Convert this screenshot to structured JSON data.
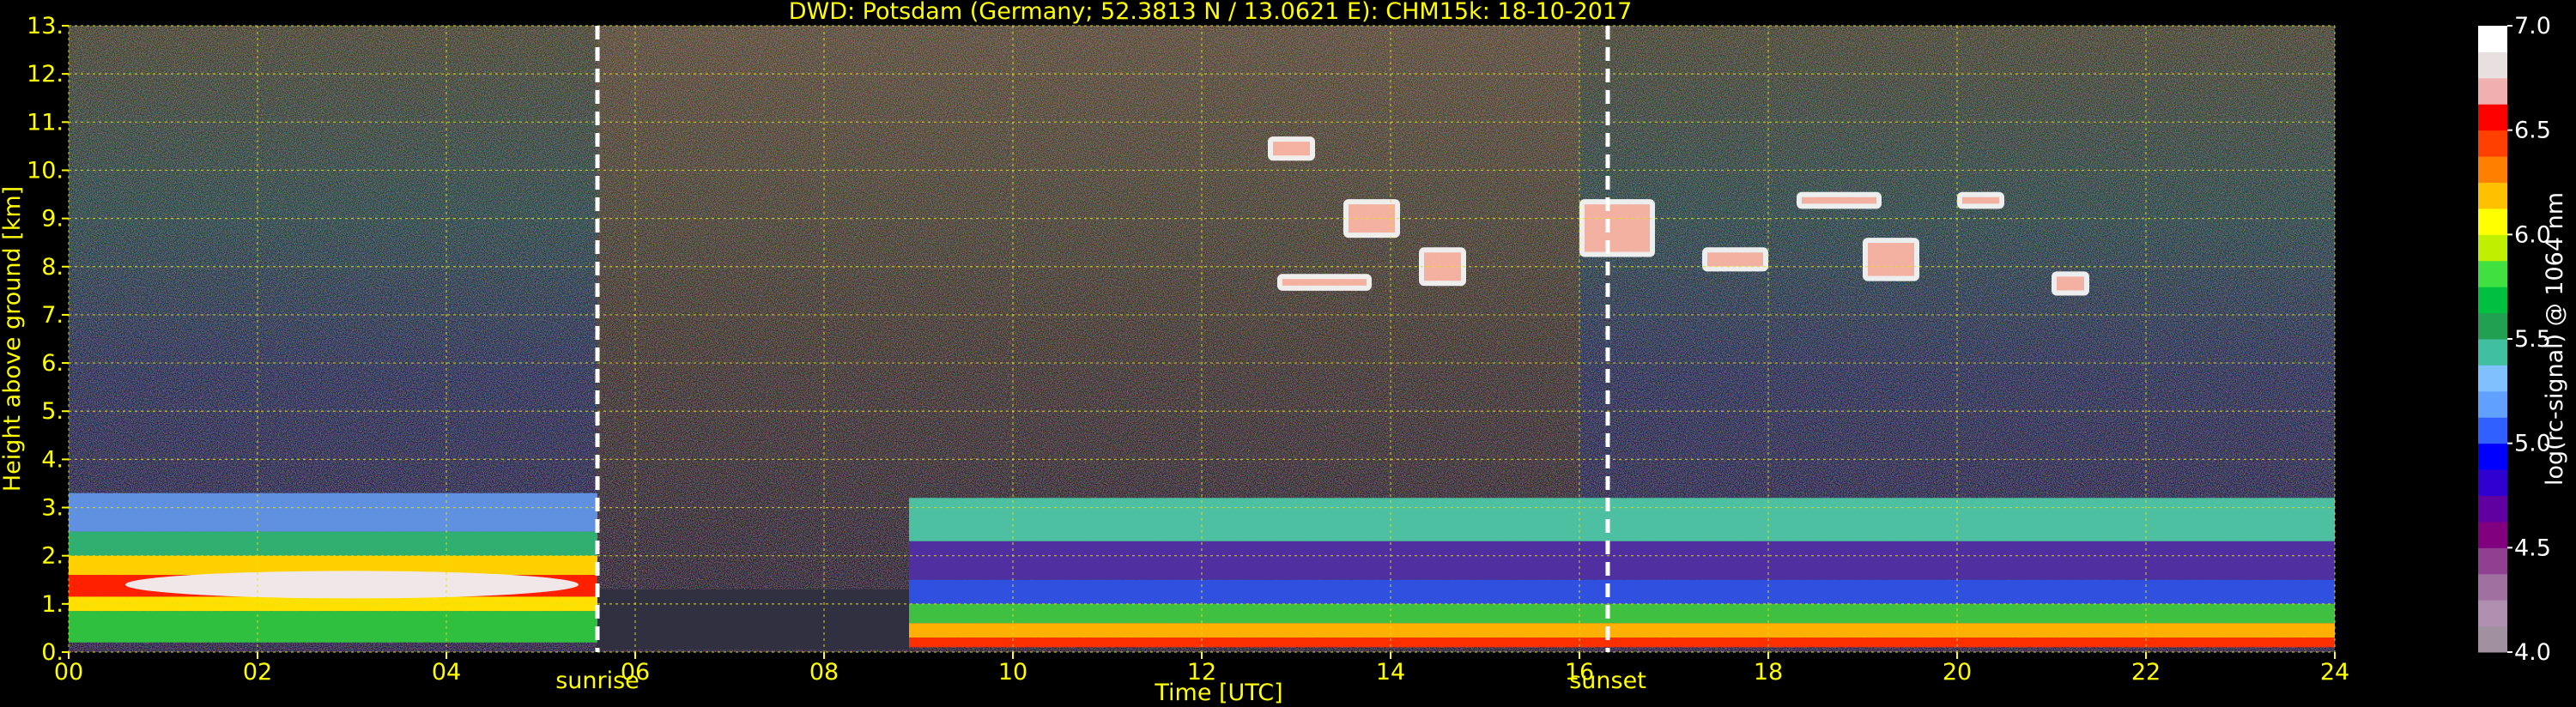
{
  "chart_data": {
    "type": "heatmap",
    "title": "DWD: Potsdam (Germany; 52.3813 N / 13.0621 E):    CHM15k: 18-10-2017",
    "xlabel": "Time [UTC]",
    "ylabel": "Height above ground [km]",
    "xlim": [
      0,
      24
    ],
    "ylim": [
      0,
      13
    ],
    "xticks": [
      "00",
      "02",
      "04",
      "06",
      "08",
      "10",
      "12",
      "14",
      "16",
      "18",
      "20",
      "22",
      "24"
    ],
    "yticks": [
      "0.",
      "1.",
      "2.",
      "3.",
      "4.",
      "5.",
      "6.",
      "7.",
      "8.",
      "9.",
      "10.",
      "11.",
      "12.",
      "13."
    ],
    "grid": true,
    "events": [
      {
        "label": "sunrise",
        "x": 5.6
      },
      {
        "label": "sunset",
        "x": 16.3
      }
    ],
    "colorbar": {
      "label": "log(rc-signal) @ 1064 nm",
      "range": [
        4.0,
        7.0
      ],
      "ticks": [
        "4.0",
        "4.5",
        "5.0",
        "5.5",
        "6.0",
        "6.5",
        "7.0"
      ],
      "colors": [
        "#a090a0",
        "#b090b0",
        "#a070a0",
        "#904090",
        "#800080",
        "#6000a0",
        "#3000d0",
        "#0000ff",
        "#3060ff",
        "#60a0ff",
        "#80c0ff",
        "#40c0a0",
        "#20a050",
        "#00c040",
        "#40e040",
        "#c0f000",
        "#ffff00",
        "#ffc000",
        "#ff8000",
        "#ff4000",
        "#ff0000",
        "#f0b0b0",
        "#e8e0e0",
        "#ffffff"
      ]
    },
    "layers": [
      {
        "name": "boundary layer (night)",
        "x": [
          0,
          5.6
        ],
        "y": [
          0.2,
          3.3
        ],
        "peak_height_km": 1.4
      },
      {
        "name": "residual layer (day)",
        "x": [
          8.9,
          24
        ],
        "y": [
          0.1,
          3.2
        ]
      },
      {
        "name": "cirrus cloud",
        "x": [
          12.5,
          21.2
        ],
        "y": [
          6.8,
          10.8
        ]
      }
    ]
  }
}
